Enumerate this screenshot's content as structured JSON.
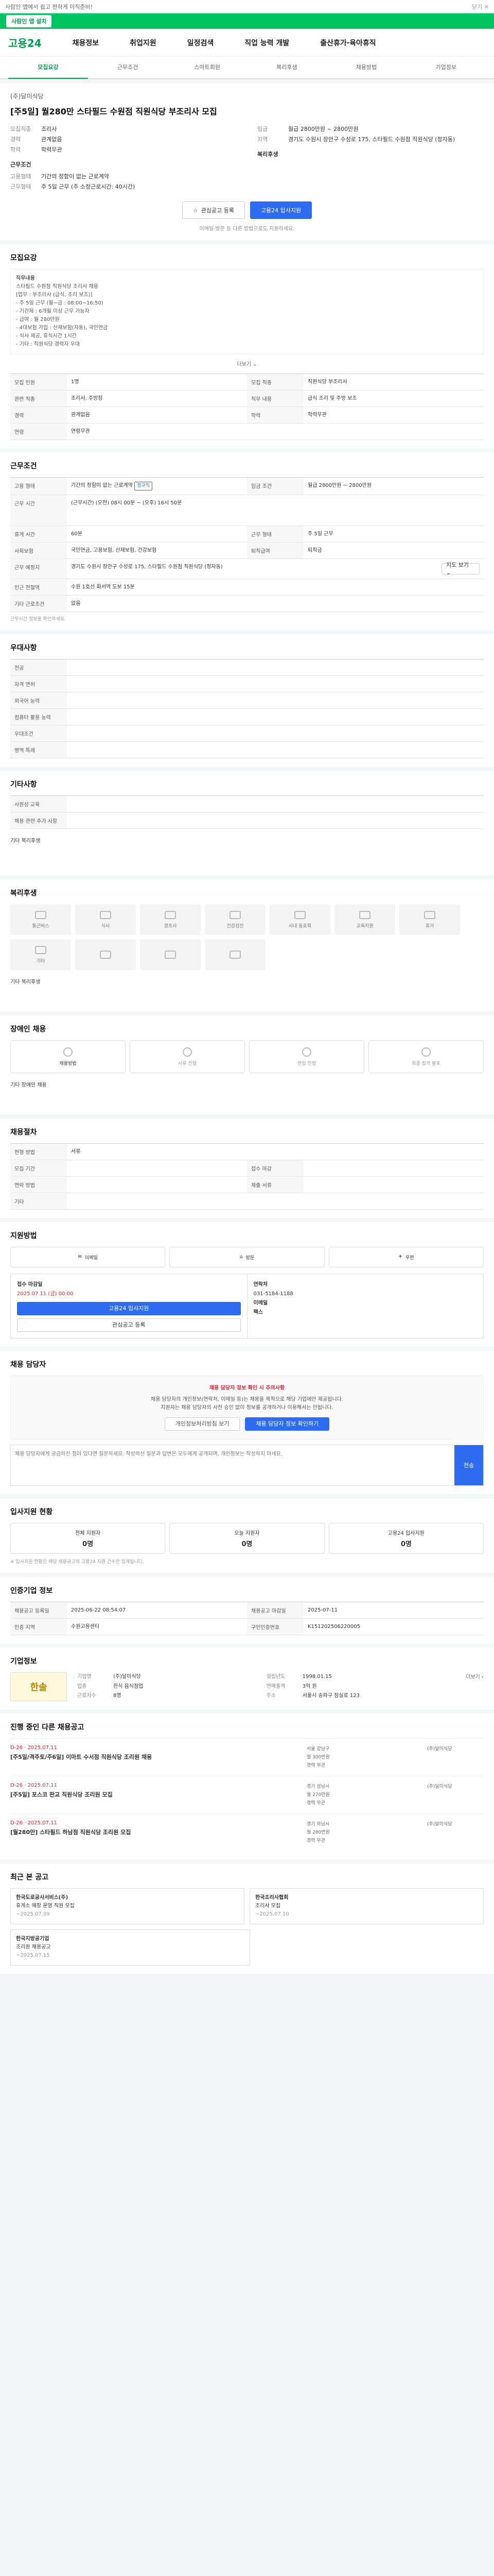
{
  "topbar": {
    "notice": "사람인 앱에서 쉽고 편하게 이직준비!",
    "close": "닫기 ✕"
  },
  "greenbar": {
    "btn": "사람인 앱 설치"
  },
  "header": {
    "logo": "고용24",
    "gnb": [
      "채용정보",
      "취업지원",
      "일정검색",
      "직업 능력 개발",
      "출산휴가·육아휴직"
    ]
  },
  "tabs": [
    "모집요강",
    "근무조건",
    "스마트회원",
    "복리후생",
    "채용방법",
    "기업정보"
  ],
  "post": {
    "company": "(주)달미식당",
    "title": "[주5일] 월280만 스타필드 수원점 직원식당 부조리사 모집",
    "left": [
      {
        "k": "모집직종",
        "v": "조리사"
      },
      {
        "k": "경력",
        "v": "관계없음"
      },
      {
        "k": "학력",
        "v": "학력무관"
      }
    ],
    "left2": [
      {
        "k": "고용형태",
        "v": "기간의 정함이 없는 근로계약"
      },
      {
        "k": "근무형태",
        "v": "주 5일 근무 (주 소정근로시간: 40시간)"
      }
    ],
    "right": [
      {
        "k": "임금",
        "v": "월급 2800만원 ~ 2800만원"
      },
      {
        "k": "지역",
        "v": "경기도 수원시 장안구 수성로 175, 스타필드 수원점 직원식당 (정자동)"
      }
    ],
    "sub1": "근무조건",
    "sub2": "복리후생"
  },
  "actions": {
    "like": "관심공고 등록",
    "apply": "고용24 입사지원"
  },
  "notice1": "이메일·방문 등 다른 방법으로도 지원하세요.",
  "s1": {
    "title": "모집요강",
    "desc": [
      "직무내용",
      "스타필드 수원점 직원식당 조리사 채용",
      "[업무 : 부조리사 (급식, 조리 보조)]",
      "- 주 5일 근무 (월~금 : 08:00~16:50)",
      "- 기간제 : 6개월 이상 근무 가능자",
      "- 급여 : 월 280만원",
      "- 4대보험 가입 : 산재보험(자동), 국민연금",
      "- 식사 제공, 휴식시간 1시간",
      "- 기타 : 직원식당 경력자 우대"
    ],
    "more": "더보기 ⌄",
    "rows": [
      {
        "k": "모집 인원",
        "v": "1명"
      },
      {
        "k": "모집 직종",
        "v": "직원식당 부조리사"
      },
      {
        "k": "관련 직종",
        "v": "조리사, 주방장"
      },
      {
        "k": "직무 내용",
        "v": "급식 조리 및 주방 보조"
      },
      {
        "k": "경력",
        "v": "관계없음"
      },
      {
        "k": "학력",
        "v": "학력무관"
      },
      {
        "k": "연령",
        "v": "연령무관"
      }
    ]
  },
  "s2": {
    "title": "근무조건",
    "rows": [
      {
        "k": "고용 형태",
        "v": "기간의 정함이 없는 근로계약",
        "b": "정규직"
      },
      {
        "k": "임금 조건",
        "v": "월급 2800만원 ~ 2800만원"
      },
      {
        "k": "근무 시간",
        "v": "(근무시간) (오전) 08시 00분 ~ (오후) 16시 50분"
      },
      {
        "k": "휴게 시간",
        "v": "60분"
      },
      {
        "k": "근무 형태",
        "v": "주 5일 근무"
      },
      {
        "k": "사회보험",
        "v": "국민연금, 고용보험, 산재보험, 건강보험"
      },
      {
        "k": "퇴직급여",
        "v": "퇴직금"
      },
      {
        "k": "근무 예정지",
        "v": "경기도 수원시 장안구 수성로 175, 스타필드 수원점 직원식당 (정자동)"
      },
      {
        "k": "인근 전철역",
        "v": "수원 1호선 화서역 도보 15분"
      },
      {
        "k": "기타 근로조건",
        "v": "없음"
      }
    ],
    "note": "근무시간 정보를 확인하세요.",
    "map": "지도 보기 ⌄"
  },
  "s3": {
    "title": "우대사항",
    "rows": [
      {
        "k": "전공",
        "v": ""
      },
      {
        "k": "자격 면허",
        "v": ""
      },
      {
        "k": "외국어 능력",
        "v": ""
      },
      {
        "k": "컴퓨터 활용 능력",
        "v": ""
      },
      {
        "k": "우대조건",
        "v": ""
      },
      {
        "k": "병역 특례",
        "v": ""
      }
    ]
  },
  "s4": {
    "title": "기타사항",
    "rows": [
      {
        "k": "사원성 교육",
        "v": ""
      },
      {
        "k": "채용 관련 추가 사항",
        "v": ""
      }
    ],
    "etc": "기타 복리후생"
  },
  "s5": {
    "title": "복리후생",
    "items": [
      "통근버스",
      "식사",
      "경조사",
      "건강검진",
      "사내 동호회",
      "교육지원",
      "휴가",
      "기타",
      "",
      "",
      ""
    ],
    "etc": "기타 복리후생"
  },
  "s6": {
    "title": "장애인 채용",
    "steps": [
      "채용방법",
      "서류 전형",
      "면접 전형",
      "최종 합격 발표"
    ],
    "etc": "기타 장애인 채용"
  },
  "s7": {
    "title": "채용절차",
    "rows": [
      {
        "k": "전형 방법",
        "v": "서류"
      },
      {
        "k": "모집 기간",
        "v": ""
      },
      {
        "k": "접수 마감",
        "v": ""
      },
      {
        "k": "연락 방법",
        "v": ""
      },
      {
        "k": "제출 서류",
        "v": ""
      },
      {
        "k": "기타",
        "v": ""
      }
    ]
  },
  "s8": {
    "title": "지원방법",
    "methods": [
      "이메일",
      "방문",
      "우편"
    ],
    "deadline": "접수 마감일",
    "date": "2025.07.11 (금) 00:00",
    "apply": "고용24 입사지원",
    "like": "관심공고 등록",
    "contact": "연락처",
    "tel": "031-5184-1188",
    "email": "이메일",
    "emailv": "",
    "fax": "팩스",
    "faxv": ""
  },
  "s9": {
    "title": "채용 담당자",
    "warn": "채용 담당자 정보 확인 시 주의사항",
    "lines": [
      "채용 담당자의 개인정보(연락처, 이메일 등)는 채용을 목적으로 해당 기업에만 제공됩니다.",
      "지원자는 채용 담당자의 사전 승인 없이 정보를 공개하거나 이용해서는 안됩니다."
    ],
    "b1": "개인정보처리방침 보기",
    "b2": "채용 담당자 정보 확인하기",
    "placeholder": "채용 담당자에게 궁금하신 점이 있다면 질문하세요. 작성하신 질문과 답변은 모두에게 공개되며, 개인정보는 작성하지 마세요.",
    "send": "전송"
  },
  "s10": {
    "title": "입사지원 현황",
    "stats": [
      {
        "k": "전체 지원자",
        "v": "0명"
      },
      {
        "k": "오늘 지원자",
        "v": "0명"
      },
      {
        "k": "고용24 입사지원",
        "v": "0명"
      }
    ],
    "note": "※ 입사지원 현황은 해당 채용공고의 고용24 지원 건수만 집계됩니다."
  },
  "s11": {
    "title": "인증기업 정보",
    "rows": [
      {
        "k": "채용공고 등록일",
        "v": "2025-06-22 08:54:07"
      },
      {
        "k": "채용공고 마감일",
        "v": "2025-07-11"
      },
      {
        "k": "인증 지역",
        "v": "수원고용센터"
      },
      {
        "k": "구인인증번호",
        "v": "K151202506220005"
      }
    ]
  },
  "s12": {
    "title": "기업정보",
    "logo": "한솔",
    "info": [
      {
        "k": "기업명",
        "v": "(주)달미식당"
      },
      {
        "k": "업종",
        "v": "한식 음식점업"
      },
      {
        "k": "근로자수",
        "v": "8명"
      },
      {
        "k": "설립년도",
        "v": "1998.01.15"
      },
      {
        "k": "주소",
        "v": "서울시 송파구 잠실로 123"
      },
      {
        "k": "연매출액",
        "v": "3억 원"
      }
    ],
    "more": "더보기 ›"
  },
  "s13": {
    "title": "진행 중인 다른 채용공고",
    "jobs": [
      {
        "dt": "D-26 · 2025.07.11",
        "t": "[주5일/격주토/주6일] 이마트 수서점 직원식당 조리원 채용",
        "m": [
          "서울 강남구",
          "월 300만원",
          "경력 무관"
        ],
        "r": "(주)달미식당"
      },
      {
        "dt": "D-26 · 2025.07.11",
        "t": "[주5일] 포스코 판교 직원식당 조리원 모집",
        "m": [
          "경기 성남시",
          "월 270만원",
          "경력 무관"
        ],
        "r": "(주)달미식당"
      },
      {
        "dt": "D-26 · 2025.07.11",
        "t": "[월280만] 스타필드 하남점 직원식당 조리원 모집",
        "m": [
          "경기 하남시",
          "월 280만원",
          "경력 무관"
        ],
        "r": "(주)달미식당"
      }
    ]
  },
  "s14": {
    "title": "최근 본 공고",
    "cards": [
      {
        "rt": "한국도로공사서비스(주)",
        "t": "휴게소 매장 운영 직원 모집",
        "d": "~2025.07.09"
      },
      {
        "rt": "한국조리사협회",
        "t": "조리사 모집",
        "d": "~2025.07.10"
      },
      {
        "rt": "한국지방공기업",
        "t": "조리원 채용공고",
        "d": "~2025.07.15"
      }
    ]
  }
}
